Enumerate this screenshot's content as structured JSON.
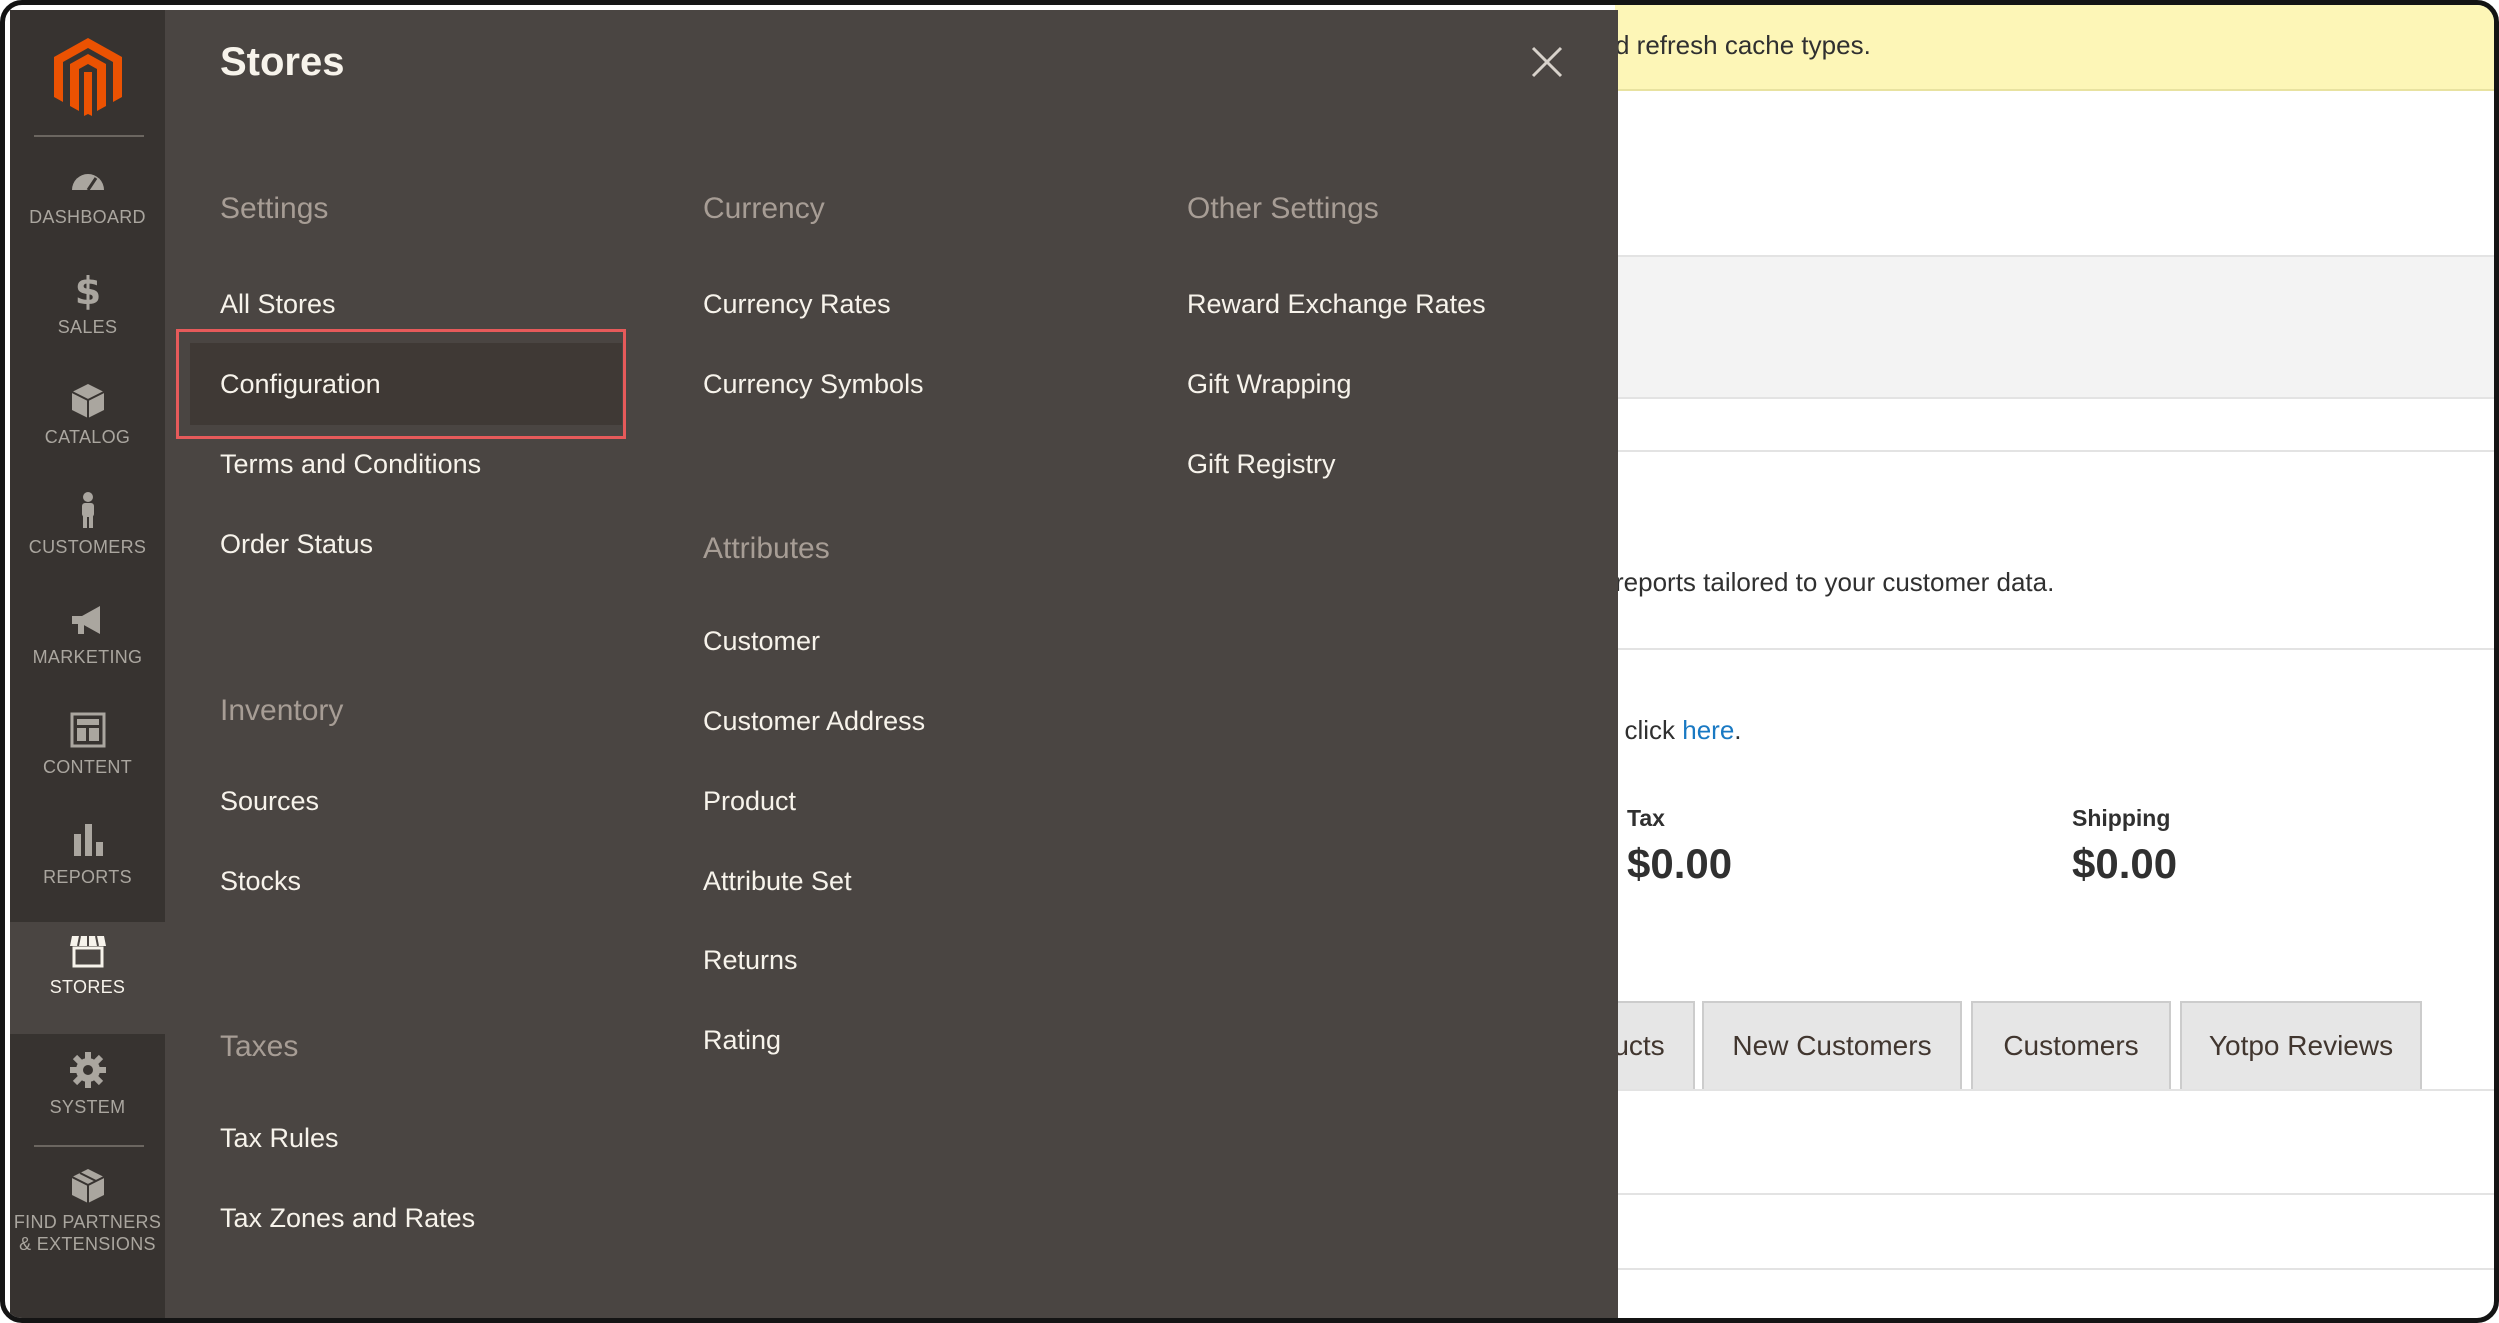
{
  "background": {
    "notice_text": "d refresh cache types.",
    "reports_text": "reports tailored to your customer data.",
    "click_text_prefix": ", click ",
    "click_link": "here",
    "click_text_suffix": ".",
    "stats": [
      {
        "label": "Tax",
        "value": "$0.00"
      },
      {
        "label": "Shipping",
        "value": "$0.00"
      }
    ],
    "tabs": [
      "ucts",
      "New Customers",
      "Customers",
      "Yotpo Reviews"
    ]
  },
  "nav": {
    "items": [
      {
        "label": "DASHBOARD",
        "icon": "dashboard-icon",
        "active": false
      },
      {
        "label": "SALES",
        "icon": "dollar-icon",
        "active": false
      },
      {
        "label": "CATALOG",
        "icon": "box-icon",
        "active": false
      },
      {
        "label": "CUSTOMERS",
        "icon": "person-icon",
        "active": false
      },
      {
        "label": "MARKETING",
        "icon": "megaphone-icon",
        "active": false
      },
      {
        "label": "CONTENT",
        "icon": "layout-icon",
        "active": false
      },
      {
        "label": "REPORTS",
        "icon": "bar-chart-icon",
        "active": false
      },
      {
        "label": "STORES",
        "icon": "storefront-icon",
        "active": true
      },
      {
        "label": "SYSTEM",
        "icon": "gear-icon",
        "active": false
      }
    ],
    "extensions": {
      "line1": "FIND PARTNERS",
      "line2": "& EXTENSIONS",
      "icon": "extensions-box-icon"
    }
  },
  "flyout": {
    "title": "Stores",
    "columns": [
      {
        "groups": [
          {
            "heading": "Settings",
            "items": [
              "All Stores",
              "Configuration",
              "Terms and Conditions",
              "Order Status"
            ]
          },
          {
            "heading": "Inventory",
            "items": [
              "Sources",
              "Stocks"
            ]
          },
          {
            "heading": "Taxes",
            "items": [
              "Tax Rules",
              "Tax Zones and Rates"
            ]
          }
        ]
      },
      {
        "groups": [
          {
            "heading": "Currency",
            "items": [
              "Currency Rates",
              "Currency Symbols"
            ]
          },
          {
            "heading": "Attributes",
            "items": [
              "Customer",
              "Customer Address",
              "Product",
              "Attribute Set",
              "Returns",
              "Rating"
            ]
          }
        ]
      },
      {
        "groups": [
          {
            "heading": "Other Settings",
            "items": [
              "Reward Exchange Rates",
              "Gift Wrapping",
              "Gift Registry"
            ]
          }
        ]
      }
    ],
    "highlighted_item": "Configuration"
  },
  "colors": {
    "nav_bg": "#373330",
    "flyout_bg": "#4a4542",
    "brand_orange": "#eb5202",
    "highlight_border": "#e65a5a",
    "link_blue": "#1979c3"
  }
}
